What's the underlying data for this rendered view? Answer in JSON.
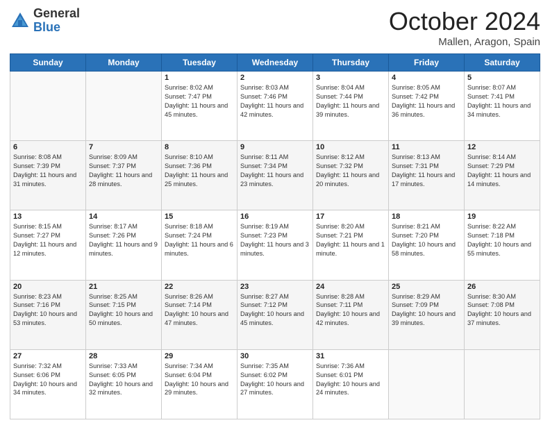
{
  "header": {
    "logo_general": "General",
    "logo_blue": "Blue",
    "month_title": "October 2024",
    "location": "Mallen, Aragon, Spain"
  },
  "weekdays": [
    "Sunday",
    "Monday",
    "Tuesday",
    "Wednesday",
    "Thursday",
    "Friday",
    "Saturday"
  ],
  "weeks": [
    [
      {
        "day": "",
        "info": ""
      },
      {
        "day": "",
        "info": ""
      },
      {
        "day": "1",
        "info": "Sunrise: 8:02 AM\nSunset: 7:47 PM\nDaylight: 11 hours and 45 minutes."
      },
      {
        "day": "2",
        "info": "Sunrise: 8:03 AM\nSunset: 7:46 PM\nDaylight: 11 hours and 42 minutes."
      },
      {
        "day": "3",
        "info": "Sunrise: 8:04 AM\nSunset: 7:44 PM\nDaylight: 11 hours and 39 minutes."
      },
      {
        "day": "4",
        "info": "Sunrise: 8:05 AM\nSunset: 7:42 PM\nDaylight: 11 hours and 36 minutes."
      },
      {
        "day": "5",
        "info": "Sunrise: 8:07 AM\nSunset: 7:41 PM\nDaylight: 11 hours and 34 minutes."
      }
    ],
    [
      {
        "day": "6",
        "info": "Sunrise: 8:08 AM\nSunset: 7:39 PM\nDaylight: 11 hours and 31 minutes."
      },
      {
        "day": "7",
        "info": "Sunrise: 8:09 AM\nSunset: 7:37 PM\nDaylight: 11 hours and 28 minutes."
      },
      {
        "day": "8",
        "info": "Sunrise: 8:10 AM\nSunset: 7:36 PM\nDaylight: 11 hours and 25 minutes."
      },
      {
        "day": "9",
        "info": "Sunrise: 8:11 AM\nSunset: 7:34 PM\nDaylight: 11 hours and 23 minutes."
      },
      {
        "day": "10",
        "info": "Sunrise: 8:12 AM\nSunset: 7:32 PM\nDaylight: 11 hours and 20 minutes."
      },
      {
        "day": "11",
        "info": "Sunrise: 8:13 AM\nSunset: 7:31 PM\nDaylight: 11 hours and 17 minutes."
      },
      {
        "day": "12",
        "info": "Sunrise: 8:14 AM\nSunset: 7:29 PM\nDaylight: 11 hours and 14 minutes."
      }
    ],
    [
      {
        "day": "13",
        "info": "Sunrise: 8:15 AM\nSunset: 7:27 PM\nDaylight: 11 hours and 12 minutes."
      },
      {
        "day": "14",
        "info": "Sunrise: 8:17 AM\nSunset: 7:26 PM\nDaylight: 11 hours and 9 minutes."
      },
      {
        "day": "15",
        "info": "Sunrise: 8:18 AM\nSunset: 7:24 PM\nDaylight: 11 hours and 6 minutes."
      },
      {
        "day": "16",
        "info": "Sunrise: 8:19 AM\nSunset: 7:23 PM\nDaylight: 11 hours and 3 minutes."
      },
      {
        "day": "17",
        "info": "Sunrise: 8:20 AM\nSunset: 7:21 PM\nDaylight: 11 hours and 1 minute."
      },
      {
        "day": "18",
        "info": "Sunrise: 8:21 AM\nSunset: 7:20 PM\nDaylight: 10 hours and 58 minutes."
      },
      {
        "day": "19",
        "info": "Sunrise: 8:22 AM\nSunset: 7:18 PM\nDaylight: 10 hours and 55 minutes."
      }
    ],
    [
      {
        "day": "20",
        "info": "Sunrise: 8:23 AM\nSunset: 7:16 PM\nDaylight: 10 hours and 53 minutes."
      },
      {
        "day": "21",
        "info": "Sunrise: 8:25 AM\nSunset: 7:15 PM\nDaylight: 10 hours and 50 minutes."
      },
      {
        "day": "22",
        "info": "Sunrise: 8:26 AM\nSunset: 7:14 PM\nDaylight: 10 hours and 47 minutes."
      },
      {
        "day": "23",
        "info": "Sunrise: 8:27 AM\nSunset: 7:12 PM\nDaylight: 10 hours and 45 minutes."
      },
      {
        "day": "24",
        "info": "Sunrise: 8:28 AM\nSunset: 7:11 PM\nDaylight: 10 hours and 42 minutes."
      },
      {
        "day": "25",
        "info": "Sunrise: 8:29 AM\nSunset: 7:09 PM\nDaylight: 10 hours and 39 minutes."
      },
      {
        "day": "26",
        "info": "Sunrise: 8:30 AM\nSunset: 7:08 PM\nDaylight: 10 hours and 37 minutes."
      }
    ],
    [
      {
        "day": "27",
        "info": "Sunrise: 7:32 AM\nSunset: 6:06 PM\nDaylight: 10 hours and 34 minutes."
      },
      {
        "day": "28",
        "info": "Sunrise: 7:33 AM\nSunset: 6:05 PM\nDaylight: 10 hours and 32 minutes."
      },
      {
        "day": "29",
        "info": "Sunrise: 7:34 AM\nSunset: 6:04 PM\nDaylight: 10 hours and 29 minutes."
      },
      {
        "day": "30",
        "info": "Sunrise: 7:35 AM\nSunset: 6:02 PM\nDaylight: 10 hours and 27 minutes."
      },
      {
        "day": "31",
        "info": "Sunrise: 7:36 AM\nSunset: 6:01 PM\nDaylight: 10 hours and 24 minutes."
      },
      {
        "day": "",
        "info": ""
      },
      {
        "day": "",
        "info": ""
      }
    ]
  ]
}
